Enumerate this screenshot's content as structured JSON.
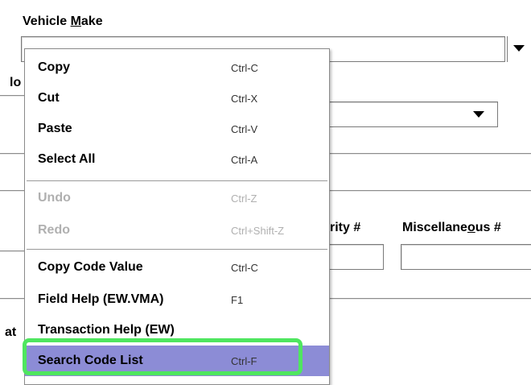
{
  "form": {
    "vehicle_make_label_pre": "Vehicle ",
    "vehicle_make_label_mnemonic": "M",
    "vehicle_make_label_post": "ake",
    "vehicle_make_value": "",
    "model_label_fragment": "lo",
    "other_select_value": "",
    "security_label_fragment": "rity #",
    "misc_label_pre": "Miscellane",
    "misc_label_mnemonic": "o",
    "misc_label_post": "us #",
    "security_value": "",
    "misc_value": "",
    "bottom_label_fragment": "at"
  },
  "context_menu": {
    "items": [
      {
        "label": "Copy",
        "shortcut": "Ctrl-C",
        "enabled": true
      },
      {
        "label": "Cut",
        "shortcut": "Ctrl-X",
        "enabled": true
      },
      {
        "label": "Paste",
        "shortcut": "Ctrl-V",
        "enabled": true
      },
      {
        "label": "Select All",
        "shortcut": "Ctrl-A",
        "enabled": true
      },
      {
        "label": "Undo",
        "shortcut": "Ctrl-Z",
        "enabled": false
      },
      {
        "label": "Redo",
        "shortcut": "Ctrl+Shift-Z",
        "enabled": false
      },
      {
        "label": "Copy Code Value",
        "shortcut": "Ctrl-C",
        "enabled": true
      },
      {
        "label": "Field Help (EW.VMA)",
        "shortcut": "F1",
        "enabled": true
      },
      {
        "label": "Transaction Help (EW)",
        "shortcut": "",
        "enabled": true
      },
      {
        "label": "Search Code List",
        "shortcut": "Ctrl-F",
        "enabled": true,
        "selected": true
      }
    ]
  },
  "colors": {
    "selection_bg": "#8c8cd6",
    "highlight_outline": "#4fe65f",
    "disabled_text": "#b0b0b0"
  }
}
